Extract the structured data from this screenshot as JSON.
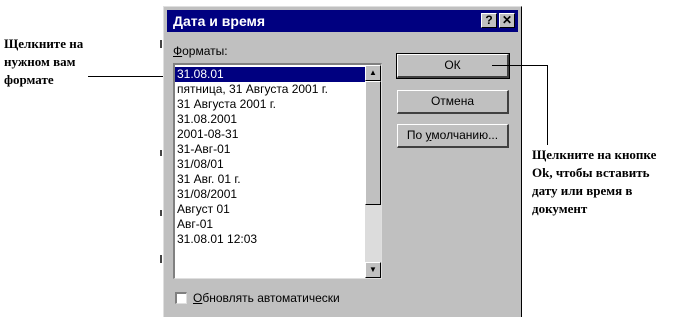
{
  "dialog": {
    "title": "Дата и время",
    "help_button": "?",
    "close_button": "✕",
    "formats_label_accel": "Ф",
    "formats_label_rest": "орматы:",
    "formats": [
      "31.08.01",
      "пятница, 31 Августа 2001 г.",
      "31 Августа 2001 г.",
      "31.08.2001",
      "2001-08-31",
      "31-Авг-01",
      "31/08/01",
      "31 Авг. 01 г.",
      "31/08/2001",
      "Август 01",
      "Авг-01",
      "31.08.01 12:03"
    ],
    "selected_index": 0,
    "scroll_up": "▲",
    "scroll_down": "▼",
    "ok_button": "ОК",
    "cancel_button": "Отмена",
    "default_button_pre": "По ",
    "default_button_accel": "у",
    "default_button_post": "молчанию...",
    "auto_update_accel": "О",
    "auto_update_rest": "бновлять автоматически",
    "auto_update_checked": false
  },
  "callouts": {
    "left": [
      "Щелкните на",
      "нужном вам",
      "формате"
    ],
    "right": [
      "Щелкните на кнопке",
      "Ok, чтобы вставить",
      "дату или время в",
      "документ"
    ]
  }
}
